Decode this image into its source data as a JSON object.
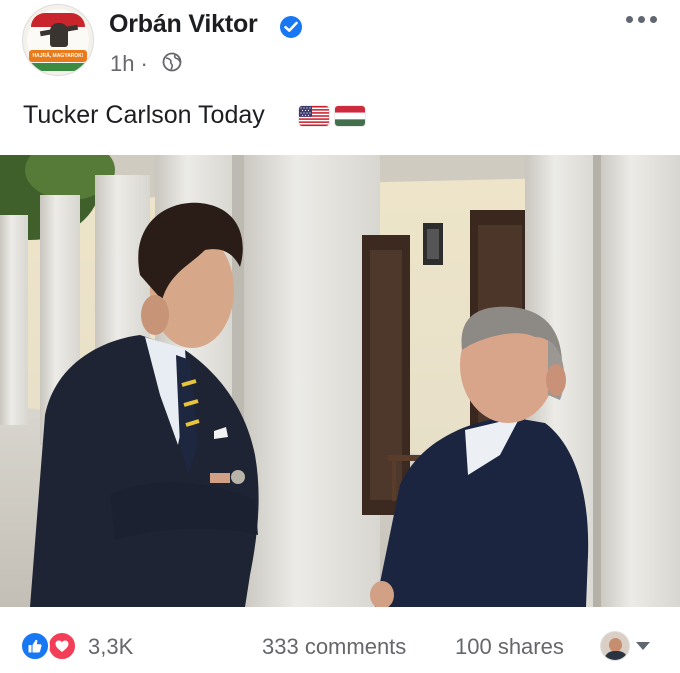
{
  "post": {
    "author": "Orbán Viktor",
    "time": "1h",
    "separator": "·",
    "avatar_banner_text": "HAJRÁ, MAGYAROK!",
    "caption": "Tucker Carlson Today",
    "caption_flags": [
      "flag-us-icon",
      "flag-hungary-icon"
    ]
  },
  "footer": {
    "reaction_count": "3,3K",
    "comments": "333 comments",
    "shares": "100 shares"
  },
  "colors": {
    "verified_blue": "#1877f2",
    "love_red": "#f33e58",
    "meta_gray": "#65676b"
  }
}
